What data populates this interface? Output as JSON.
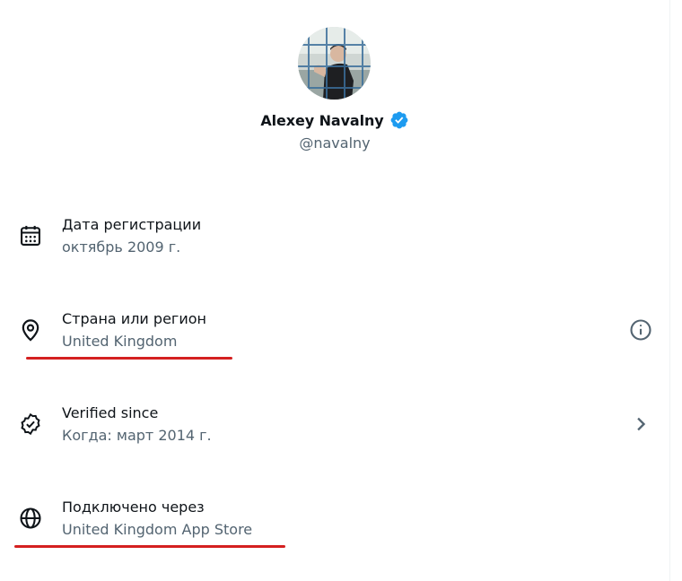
{
  "profile": {
    "name": "Alexey Navalny",
    "handle": "@navalny",
    "verified": true
  },
  "rows": [
    {
      "title": "Дата регистрации",
      "value": "октябрь 2009 г.",
      "icon": "calendar-icon"
    },
    {
      "title": "Страна или регион",
      "value": "United Kingdom",
      "icon": "location-pin-icon",
      "trailing_icon": "info-icon"
    },
    {
      "title": "Verified since",
      "value": "Когда: март 2014 г.",
      "icon": "verified-badge-outline-icon",
      "trailing_icon": "chevron-right-icon"
    },
    {
      "title": "Подключено через",
      "value": "United Kingdom App Store",
      "icon": "globe-icon"
    }
  ],
  "colors": {
    "primary_text": "#0f1419",
    "secondary_text": "#536471",
    "verified_blue": "#1d9bf0",
    "annotation_red": "#d42020"
  }
}
